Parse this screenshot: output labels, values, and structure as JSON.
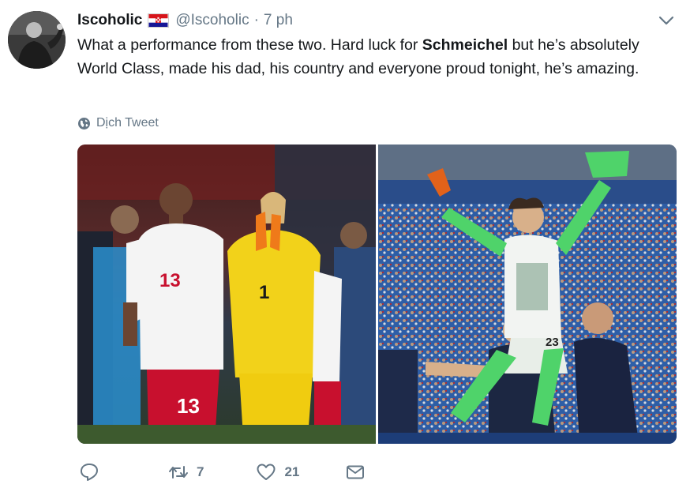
{
  "tweet": {
    "display_name": "Iscoholic",
    "flag_icon": "croatia-flag-icon",
    "handle": "@Iscoholic",
    "separator": "·",
    "timestamp": "7 ph",
    "text_part1": "What a performance from these two. Hard luck for ",
    "text_bold": "Schmeichel",
    "text_part2": " but he’s absolutely World Class, made his dad, his country and everyone proud tonight, he’s amazing.",
    "translate_label": "Dịch Tweet",
    "photos": [
      {
        "name": "denmark-players-photo",
        "shirt_number_white": "13",
        "shirt_number_yellow": "1",
        "shorts_number": "13"
      },
      {
        "name": "croatia-goalkeeper-celebration-photo",
        "shirt_number": "23"
      }
    ],
    "actions": {
      "reply_icon": "reply-icon",
      "retweet_icon": "retweet-icon",
      "retweet_count": "7",
      "like_icon": "heart-icon",
      "like_count": "21",
      "message_icon": "envelope-icon"
    }
  },
  "colors": {
    "text": "#14171a",
    "secondary": "#657786"
  }
}
